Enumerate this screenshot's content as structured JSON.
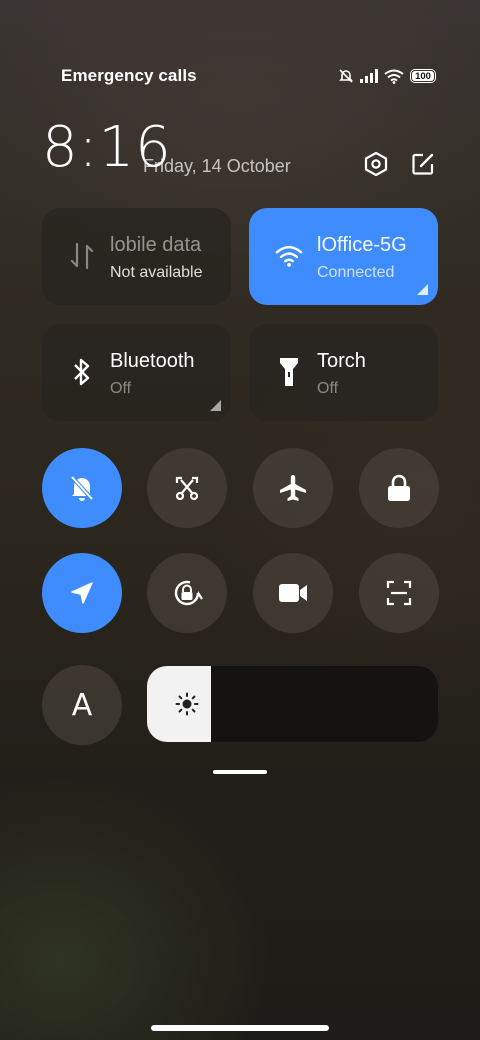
{
  "status_bar": {
    "carrier_text": "Emergency calls",
    "battery_level": "100",
    "icons": [
      "silent-icon",
      "signal-icon",
      "wifi-icon",
      "battery-icon"
    ]
  },
  "header": {
    "time": "8:16",
    "date": "Friday, 14 October",
    "settings_icon": "settings-hexagon-icon",
    "edit_icon": "edit-icon"
  },
  "tiles": {
    "mobile_data": {
      "title": "lobile data",
      "subtitle": "Not available",
      "icon": "mobile-data-arrows-icon",
      "active": false
    },
    "wifi": {
      "title": "lOffice-5G",
      "subtitle": "Connected",
      "icon": "wifi-icon",
      "active": true
    },
    "bluetooth": {
      "title": "Bluetooth",
      "subtitle": "Off",
      "icon": "bluetooth-icon",
      "active": false
    },
    "torch": {
      "title": "Torch",
      "subtitle": "Off",
      "icon": "torch-icon",
      "active": false
    }
  },
  "toggles_row1": [
    {
      "name": "silent-mode",
      "icon": "bell-off-icon",
      "on": true
    },
    {
      "name": "screenshot",
      "icon": "scissors-screenshot-icon",
      "on": false
    },
    {
      "name": "airplane-mode",
      "icon": "airplane-icon",
      "on": false
    },
    {
      "name": "lock-screen",
      "icon": "lock-icon",
      "on": false
    }
  ],
  "toggles_row2": [
    {
      "name": "location",
      "icon": "location-arrow-icon",
      "on": true
    },
    {
      "name": "rotation-lock",
      "icon": "rotation-lock-icon",
      "on": false
    },
    {
      "name": "screen-recorder",
      "icon": "video-camera-icon",
      "on": false
    },
    {
      "name": "scanner",
      "icon": "scan-icon",
      "on": false
    }
  ],
  "font_toggle": {
    "label": "A"
  },
  "brightness": {
    "level": 0.22,
    "icon": "sun-icon"
  },
  "colors": {
    "accent": "#3f8cff"
  }
}
